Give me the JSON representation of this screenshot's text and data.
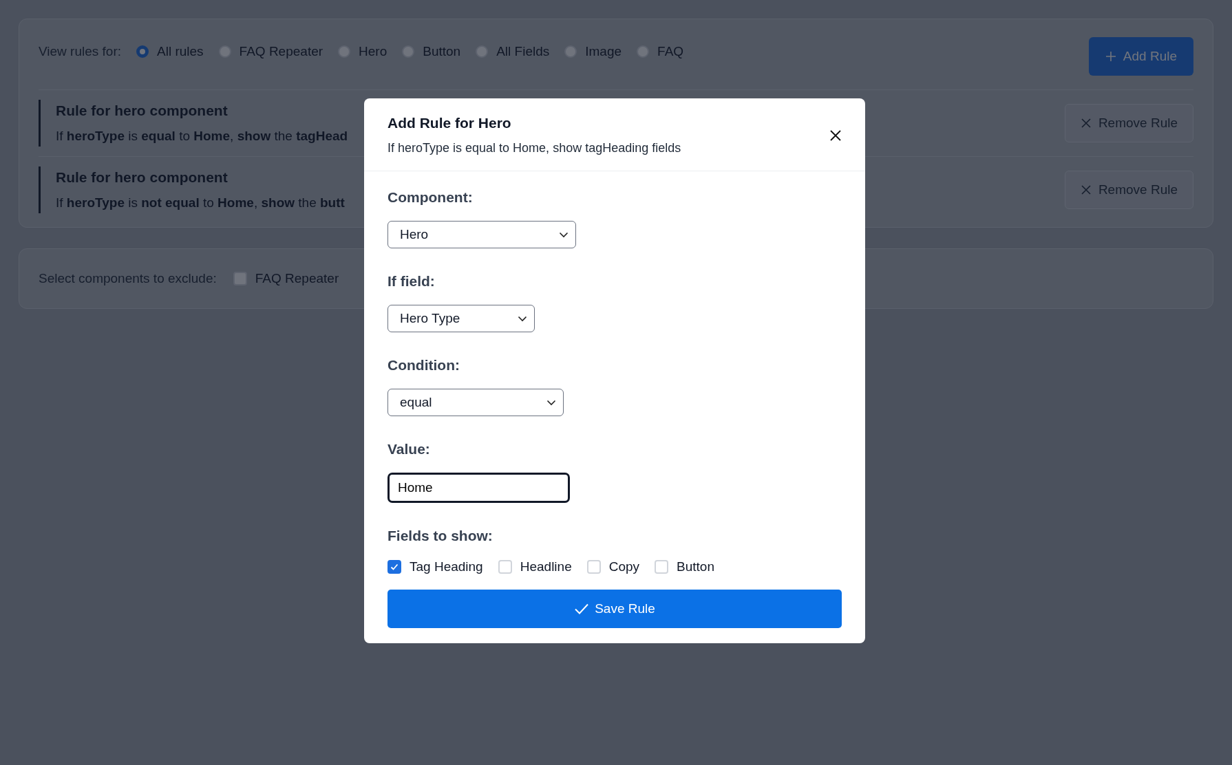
{
  "filter": {
    "label": "View rules for:",
    "options": [
      {
        "label": "All rules",
        "selected": true
      },
      {
        "label": "FAQ Repeater",
        "selected": false
      },
      {
        "label": "Hero",
        "selected": false
      },
      {
        "label": "Button",
        "selected": false
      },
      {
        "label": "All Fields",
        "selected": false
      },
      {
        "label": "Image",
        "selected": false
      },
      {
        "label": "FAQ",
        "selected": false
      }
    ]
  },
  "add_button": "Add Rule",
  "rules": [
    {
      "title": "Rule for hero component",
      "description": "If **heroType** is **equal** to **Home**, **show** the **tagHead**",
      "remove_button": "Remove Rule"
    },
    {
      "title": "Rule for hero component",
      "description": "If **heroType** is **not equal** to **Home**, **show** the **butt**",
      "remove_button": "Remove Rule"
    }
  ],
  "exclude": {
    "label": "Select components to exclude:",
    "options": [
      {
        "label": "FAQ Repeater",
        "checked": false
      }
    ]
  },
  "modal": {
    "title": "Add Rule for Hero",
    "subtitle": "If heroType is equal to Home, show tagHeading fields",
    "fields": [
      {
        "kind": "select",
        "label": "Component:",
        "value": "Hero"
      },
      {
        "kind": "select",
        "label": "If field:",
        "value": "Hero Type"
      },
      {
        "kind": "select",
        "label": "Condition:",
        "value": "equal"
      },
      {
        "kind": "input",
        "label": "Value:",
        "value": "Home"
      }
    ],
    "fields_to_show": {
      "label": "Fields to show:",
      "options": [
        {
          "label": "Tag Heading",
          "checked": true
        },
        {
          "label": "Headline",
          "checked": false
        },
        {
          "label": "Copy",
          "checked": false
        },
        {
          "label": "Button",
          "checked": false
        }
      ]
    },
    "save_button": "Save Rule"
  }
}
